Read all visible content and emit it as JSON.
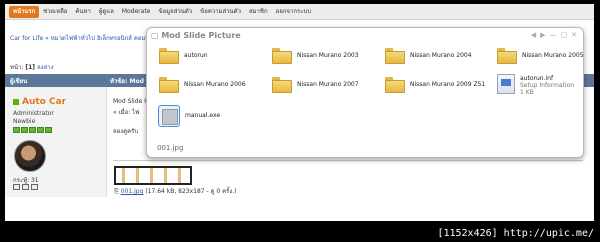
{
  "topnav": {
    "items": [
      "หน้าแรก",
      "ช่วยเหลือ",
      "ค้นหา",
      "ผู้ดูแล",
      "Moderate",
      "ข้อมูลส่วนตัว",
      "ข้อความส่วนตัว",
      "สมาชิก",
      "ออกจากระบบ"
    ],
    "active_index": 0
  },
  "breadcrumb": "Car for Life » หมวดไฟฟ้าทั่วไป อิเล็กทรอนิกส์ คอมพิวเตอร์",
  "pagination": {
    "label": "หน้า:",
    "current": "[1]",
    "next": "ลงล่าง"
  },
  "post_header": {
    "author_col": "ผู้เขียน",
    "subject_col": "หัวข้อ: Mod"
  },
  "user": {
    "name": "Auto Car",
    "role": "Administrator",
    "rank": "Newbie",
    "stars": 5,
    "posts": "กระทู้: 31"
  },
  "post": {
    "title": "Mod Slide Picture",
    "date": "« เมื่อ: ไฟ",
    "body": "ลองดูครับ",
    "attachment_name": "001.jpg",
    "attachment_info": "(17.64 kB, 823x187 - ดู 0 ครั้ง.)"
  },
  "modal": {
    "title": "Mod Slide Picture",
    "footer": "001.jpg",
    "items": [
      {
        "label": "autorun",
        "type": "folder"
      },
      {
        "label": "Nissan Murano 2003",
        "type": "folder"
      },
      {
        "label": "Nissan Murano 2004",
        "type": "folder"
      },
      {
        "label": "Nissan Murano 2005",
        "type": "folder"
      },
      {
        "label": "Nissan Murano 2006",
        "type": "folder"
      },
      {
        "label": "Nissan Murano 2007",
        "type": "folder"
      },
      {
        "label": "Nissan Murano 2009 Z51",
        "type": "folder"
      },
      {
        "label": "autorun.inf",
        "sub1": "Setup Information",
        "sub2": "1 KB",
        "type": "inf"
      },
      {
        "label": "manual.exe",
        "type": "exe"
      }
    ]
  },
  "watermark": "[1152x426] http://upic.me/",
  "colors": {
    "nav_active": "#e07a1f",
    "post_header": "#5b7799",
    "username": "#e07a1f",
    "link": "#2a5aa8"
  }
}
